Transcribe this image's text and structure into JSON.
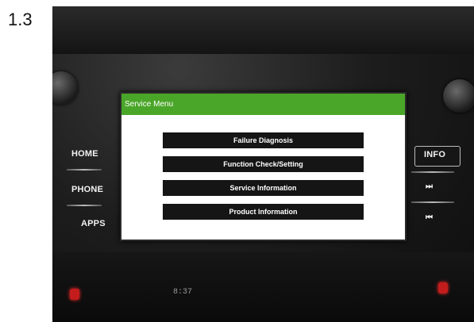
{
  "step_label": "1.3",
  "screen": {
    "title": "Service Menu",
    "menu_items": [
      "Failure Diagnosis",
      "Function Check/Setting",
      "Service Information",
      "Product Information"
    ]
  },
  "left_buttons": [
    "HOME",
    "PHONE",
    "APPS"
  ],
  "right_buttons": {
    "info": "INFO",
    "next_icon": "⏭",
    "prev_icon": "⏮"
  },
  "clock": "8:37",
  "colors": {
    "header_green": "#4aa628",
    "menu_button": "#151515",
    "seat_heater": "#c31c1c"
  }
}
